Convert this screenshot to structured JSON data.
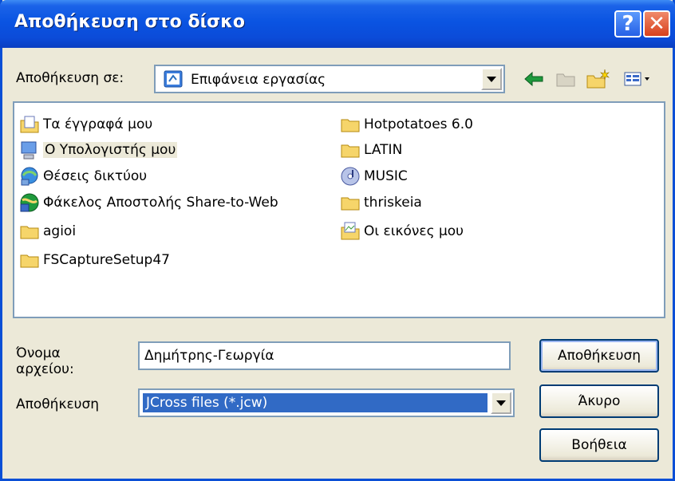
{
  "window": {
    "title": "Αποθήκευση στο δίσκο",
    "help_glyph": "?",
    "close_glyph": "✕"
  },
  "toolbar": {
    "save_in_label": "Αποθήκευση σε:",
    "save_in_value": "Επιφάνεια εργασίας",
    "icons": [
      "back-icon",
      "up-folder-icon",
      "new-folder-icon",
      "view-menu-icon"
    ]
  },
  "files": [
    {
      "name": "Τα έγγραφά μου",
      "icon": "my-documents-icon"
    },
    {
      "name": "Ο Υπολογιστής μου",
      "icon": "my-computer-icon"
    },
    {
      "name": "Θέσεις δικτύου",
      "icon": "network-places-icon"
    },
    {
      "name": "Φάκελος Αποστολής Share-to-Web",
      "icon": "share-to-web-icon"
    },
    {
      "name": "agioi",
      "icon": "folder-icon"
    },
    {
      "name": "FSCaptureSetup47",
      "icon": "folder-icon"
    },
    {
      "name": "Hotpotatoes 6.0",
      "icon": "folder-icon"
    },
    {
      "name": "LATIN",
      "icon": "folder-icon"
    },
    {
      "name": "MUSIC",
      "icon": "music-disc-icon"
    },
    {
      "name": "thriskeia",
      "icon": "folder-icon"
    },
    {
      "name": "Οι εικόνες μου",
      "icon": "my-pictures-icon"
    }
  ],
  "form": {
    "filename_label_1": "Όνομα",
    "filename_label_2": "αρχείου:",
    "filename_value": "Δημήτρης-Γεωργία",
    "savetype_label": "Αποθήκευση",
    "savetype_value": "JCross files (*.jcw)"
  },
  "buttons": {
    "save": "Αποθήκευση",
    "cancel": "Άκυρο",
    "help": "Βοήθεια"
  }
}
